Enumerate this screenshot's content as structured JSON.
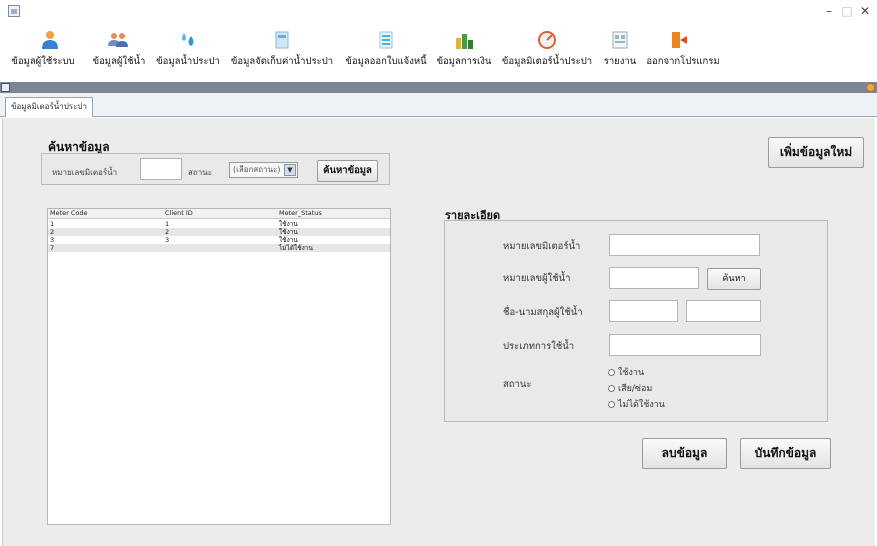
{
  "window": {
    "minimize": "–",
    "maximize": "□",
    "close": "✕"
  },
  "toolbar": {
    "items": [
      {
        "label": "ข้อมูลผู้ใช้ระบบ",
        "icon": "user-icon"
      },
      {
        "label": "ข้อมูลผู้ใช้น้ำ",
        "icon": "users-group-icon"
      },
      {
        "label": "ข้อมูลน้ำประปา",
        "icon": "water-drops-icon"
      },
      {
        "label": "ข้อมูลจัดเก็บค่าน้ำประปา",
        "icon": "bill-document-icon"
      },
      {
        "label": "ข้อมูลออกใบแจ้งหนี้",
        "icon": "invoice-icon"
      },
      {
        "label": "ข้อมูลการเงิน",
        "icon": "money-icon"
      },
      {
        "label": "ข้อมูลมิเตอร์น้ำประปา",
        "icon": "meter-gauge-icon"
      },
      {
        "label": "รายงาน",
        "icon": "report-icon"
      },
      {
        "label": "ออกจากโปรแกรม",
        "icon": "exit-door-icon"
      }
    ]
  },
  "tab": {
    "label": "ข้อมูลมิเตอร์น้ำประปา"
  },
  "search": {
    "title": "ค้นหาข้อมูล",
    "meter_label": "หมายเลขมิเตอร์น้ำ",
    "meter_value": "",
    "status_label": "สถานะ",
    "status_selected": "(เลือกสถานะ)",
    "search_button": "ค้นหาข้อมูล"
  },
  "add_button": "เพิ่มข้อมูลใหม่",
  "table": {
    "columns": [
      "Meter Code",
      "Client ID",
      "Meter_Status"
    ],
    "rows": [
      [
        "1",
        "1",
        "ใช้งาน"
      ],
      [
        "2",
        "2",
        "ใช้งาน"
      ],
      [
        "3",
        "3",
        "ใช้งาน"
      ],
      [
        "7",
        "",
        "ไม่ได้ใช้งาน"
      ]
    ]
  },
  "detail": {
    "title": "รายละเอียด",
    "meter_label": "หมายเลขมิเตอร์น้ำ",
    "client_label": "หมายเลขผู้ใช้น้ำ",
    "client_search_button": "ค้นหา",
    "name_label": "ชื่อ-นามสกุลผู้ใช้น้ำ",
    "usage_type_label": "ประเภทการใช้น้ำ",
    "status_label": "สถานะ",
    "status_options": [
      "ใช้งาน",
      "เสีย/ซ่อม",
      "ไม่ได้ใช้งาน"
    ]
  },
  "delete_button": "ลบข้อมูล",
  "save_button": "บันทึกข้อมูล"
}
